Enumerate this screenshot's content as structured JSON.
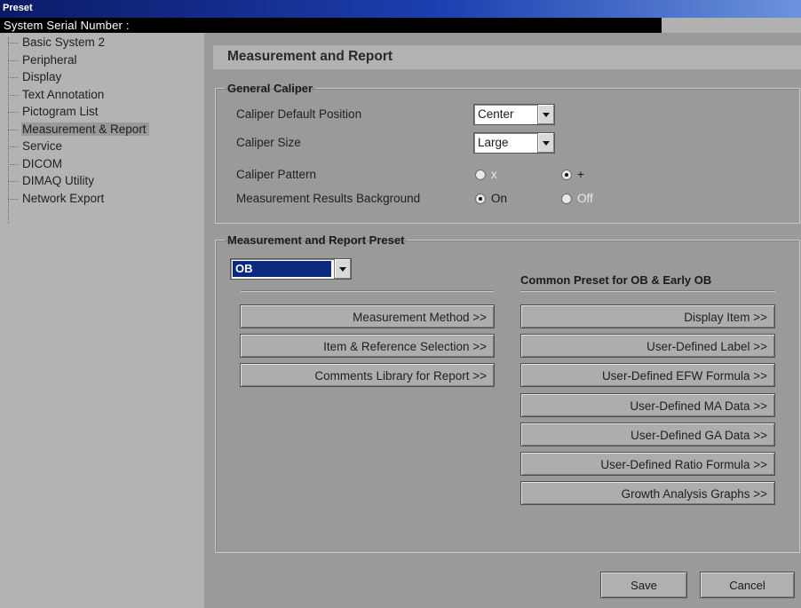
{
  "window": {
    "title": "Preset"
  },
  "serial": {
    "label": "System Serial Number :"
  },
  "sidebar": {
    "items": [
      {
        "label": "Basic System 2"
      },
      {
        "label": "Peripheral"
      },
      {
        "label": "Display"
      },
      {
        "label": "Text Annotation"
      },
      {
        "label": "Pictogram List"
      },
      {
        "label": "Measurement & Report"
      },
      {
        "label": "Service"
      },
      {
        "label": "DICOM"
      },
      {
        "label": "DIMAQ Utility"
      },
      {
        "label": "Network Export"
      }
    ],
    "selected": "Measurement & Report"
  },
  "main": {
    "title": "Measurement and Report",
    "general_caliper": {
      "legend": "General Caliper",
      "default_position": {
        "label": "Caliper Default Position",
        "value": "Center"
      },
      "size": {
        "label": "Caliper Size",
        "value": "Large"
      },
      "pattern": {
        "label": "Caliper Pattern",
        "option_x": "x",
        "option_plus": "+",
        "selected": "+"
      },
      "results_bg": {
        "label": "Measurement Results Background",
        "option_on": "On",
        "option_off": "Off",
        "selected": "On"
      }
    },
    "preset": {
      "legend": "Measurement and Report Preset",
      "selected": "OB",
      "common_title": "Common Preset for OB & Early OB",
      "left_buttons": [
        {
          "label": "Measurement Method >>"
        },
        {
          "label": "Item & Reference Selection >>"
        },
        {
          "label": "Comments Library for Report >>"
        }
      ],
      "right_buttons": [
        {
          "label": "Display Item >>"
        },
        {
          "label": "User-Defined Label >>"
        },
        {
          "label": "User-Defined EFW Formula >>"
        },
        {
          "label": "User-Defined MA Data >>"
        },
        {
          "label": "User-Defined GA Data >>"
        },
        {
          "label": "User-Defined Ratio Formula >>"
        },
        {
          "label": "Growth Analysis Graphs >>"
        }
      ]
    },
    "save_label": "Save",
    "cancel_label": "Cancel"
  }
}
